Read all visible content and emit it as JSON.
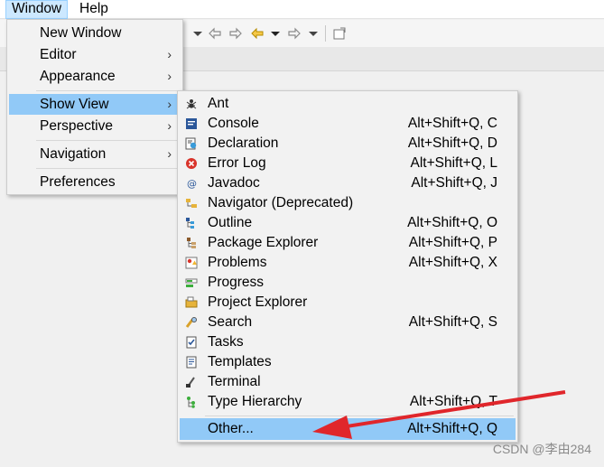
{
  "menubar": {
    "window": "Window",
    "help": "Help"
  },
  "window_menu": {
    "items": [
      "New Window",
      "Editor",
      "Appearance",
      "Show View",
      "Perspective",
      "Navigation",
      "Preferences"
    ]
  },
  "show_view_menu": {
    "items": [
      {
        "label": "Ant",
        "accel": ""
      },
      {
        "label": "Console",
        "accel": "Alt+Shift+Q, C"
      },
      {
        "label": "Declaration",
        "accel": "Alt+Shift+Q, D"
      },
      {
        "label": "Error Log",
        "accel": "Alt+Shift+Q, L"
      },
      {
        "label": "Javadoc",
        "accel": "Alt+Shift+Q, J"
      },
      {
        "label": "Navigator (Deprecated)",
        "accel": ""
      },
      {
        "label": "Outline",
        "accel": "Alt+Shift+Q, O"
      },
      {
        "label": "Package Explorer",
        "accel": "Alt+Shift+Q, P"
      },
      {
        "label": "Problems",
        "accel": "Alt+Shift+Q, X"
      },
      {
        "label": "Progress",
        "accel": ""
      },
      {
        "label": "Project Explorer",
        "accel": ""
      },
      {
        "label": "Search",
        "accel": "Alt+Shift+Q, S"
      },
      {
        "label": "Tasks",
        "accel": ""
      },
      {
        "label": "Templates",
        "accel": ""
      },
      {
        "label": "Terminal",
        "accel": ""
      },
      {
        "label": "Type Hierarchy",
        "accel": "Alt+Shift+Q, T"
      },
      {
        "label": "Other...",
        "accel": "Alt+Shift+Q, Q"
      }
    ]
  },
  "watermark": "CSDN @李由284",
  "colors": {
    "highlight": "#91c9f7",
    "annotation_arrow": "#e0262b"
  }
}
